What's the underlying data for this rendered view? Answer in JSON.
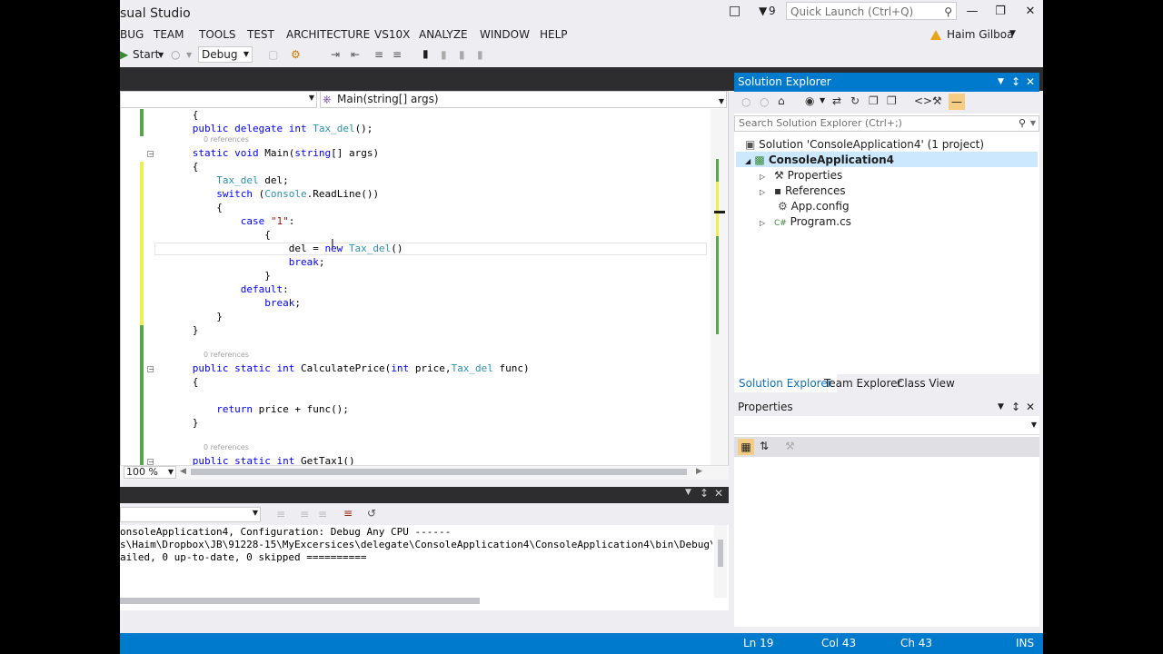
{
  "title": {
    "app_name": "sual Studio",
    "notifications_count": "9",
    "quick_launch_placeholder": "Quick Launch (Ctrl+Q)"
  },
  "menu": [
    "BUG",
    "TEAM",
    "TOOLS",
    "TEST",
    "ARCHITECTURE",
    "VS10X",
    "ANALYZE",
    "WINDOW",
    "HELP"
  ],
  "user": {
    "name": "Haim Gilboa"
  },
  "toolbar": {
    "start_label": "Start",
    "config_value": "Debug"
  },
  "editor": {
    "member_dropdown": "Main(string[] args)",
    "zoom": "100 %",
    "lines": [
      {
        "kind": "code",
        "text": "    {"
      },
      {
        "kind": "code",
        "parts": [
          [
            "    ",
            ""
          ],
          [
            "public delegate int ",
            "kw"
          ],
          [
            "Tax_del",
            "ty"
          ],
          [
            "();",
            ""
          ]
        ]
      },
      {
        "kind": "ref",
        "text": "0 references"
      },
      {
        "kind": "code",
        "parts": [
          [
            "    ",
            ""
          ],
          [
            "static void ",
            "kw"
          ],
          [
            "Main(",
            ""
          ],
          [
            "string",
            "kw"
          ],
          [
            "[] args)",
            ""
          ]
        ]
      },
      {
        "kind": "code",
        "text": "    {"
      },
      {
        "kind": "code",
        "parts": [
          [
            "        ",
            ""
          ],
          [
            "Tax_del",
            "ty"
          ],
          [
            " del;",
            ""
          ]
        ]
      },
      {
        "kind": "code",
        "parts": [
          [
            "        ",
            ""
          ],
          [
            "switch",
            "kw"
          ],
          [
            " (",
            ""
          ],
          [
            "Console",
            "ty"
          ],
          [
            ".ReadLine())",
            ""
          ]
        ]
      },
      {
        "kind": "code",
        "text": "        {"
      },
      {
        "kind": "code",
        "parts": [
          [
            "            ",
            ""
          ],
          [
            "case ",
            "kw"
          ],
          [
            "\"1\"",
            "str"
          ],
          [
            ":",
            ""
          ]
        ]
      },
      {
        "kind": "code",
        "text": "                {"
      },
      {
        "kind": "code",
        "parts": [
          [
            "                    del = ",
            ""
          ],
          [
            "new ",
            "kw"
          ],
          [
            "Tax_del",
            "ty"
          ],
          [
            "()",
            ""
          ]
        ]
      },
      {
        "kind": "code",
        "parts": [
          [
            "                    ",
            ""
          ],
          [
            "break",
            "kw"
          ],
          [
            ";",
            ""
          ]
        ]
      },
      {
        "kind": "code",
        "text": "                }"
      },
      {
        "kind": "code",
        "parts": [
          [
            "            ",
            ""
          ],
          [
            "default",
            "kw"
          ],
          [
            ":",
            ""
          ]
        ]
      },
      {
        "kind": "code",
        "parts": [
          [
            "                ",
            ""
          ],
          [
            "break",
            "kw"
          ],
          [
            ";",
            ""
          ]
        ]
      },
      {
        "kind": "code",
        "text": "        }"
      },
      {
        "kind": "code",
        "text": "    }"
      },
      {
        "kind": "blank",
        "text": ""
      },
      {
        "kind": "ref",
        "text": "0 references"
      },
      {
        "kind": "code",
        "parts": [
          [
            "    ",
            ""
          ],
          [
            "public static int ",
            "kw"
          ],
          [
            "CalculatePrice(",
            ""
          ],
          [
            "int ",
            "kw"
          ],
          [
            "price,",
            ""
          ],
          [
            "Tax_del",
            "ty"
          ],
          [
            " func)",
            ""
          ]
        ]
      },
      {
        "kind": "code",
        "text": "    {"
      },
      {
        "kind": "blank",
        "text": ""
      },
      {
        "kind": "code",
        "parts": [
          [
            "        ",
            ""
          ],
          [
            "return ",
            "kw"
          ],
          [
            "price + func();",
            ""
          ]
        ]
      },
      {
        "kind": "code",
        "text": "    }"
      },
      {
        "kind": "blank",
        "text": ""
      },
      {
        "kind": "ref",
        "text": "0 references"
      },
      {
        "kind": "code",
        "parts": [
          [
            "    ",
            ""
          ],
          [
            "public static int ",
            "kw"
          ],
          [
            "GetTax1()",
            ""
          ]
        ]
      }
    ]
  },
  "output": {
    "lines": [
      "onsoleApplication4, Configuration: Debug Any CPU ------",
      "s\\Haim\\Dropbox\\JB\\91228-15\\MyExcersices\\delegate\\ConsoleApplication4\\ConsoleApplication4\\bin\\Debug\\",
      "ailed, 0 up-to-date, 0 skipped =========="
    ]
  },
  "solution_explorer": {
    "title": "Solution Explorer",
    "search_placeholder": "Search Solution Explorer (Ctrl+;)",
    "solution": "Solution 'ConsoleApplication4' (1 project)",
    "project": "ConsoleApplication4",
    "items": [
      "Properties",
      "References",
      "App.config",
      "Program.cs"
    ],
    "tabs": [
      "Solution Explorer",
      "Team Explorer",
      "Class View"
    ]
  },
  "properties": {
    "title": "Properties"
  },
  "status": {
    "ln": "Ln 19",
    "col": "Col 43",
    "ch": "Ch 43",
    "mode": "INS"
  }
}
